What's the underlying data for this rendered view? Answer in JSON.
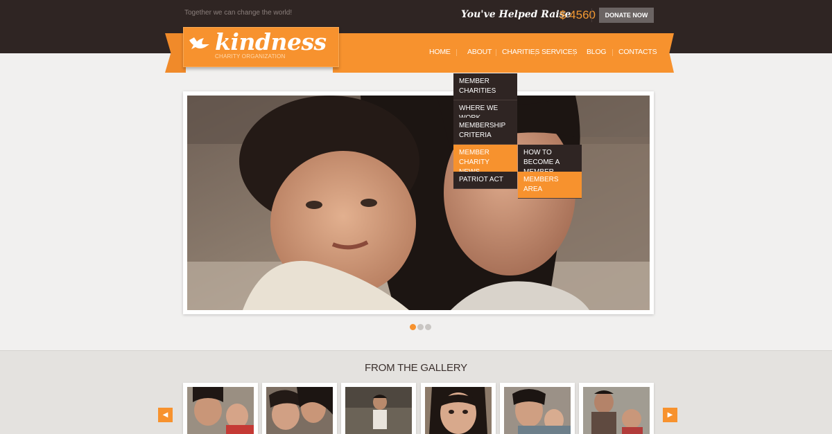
{
  "header": {
    "tagline": "Together we can change the world!",
    "raise_label": "You've Helped Raise",
    "raise_amount": "$ 4560",
    "donate_label": "DONATE NOW"
  },
  "logo": {
    "title": "kindness",
    "subtitle": "CHARITY ORGANIZATION"
  },
  "nav": {
    "items": [
      "HOME",
      "ABOUT",
      "CHARITIES",
      "SERVICES",
      "BLOG",
      "CONTACTS"
    ]
  },
  "dropdown": {
    "items": [
      {
        "label": "MEMBER CHARITIES"
      },
      {
        "label": "WHERE WE WORK"
      },
      {
        "label": "MEMBERSHIP CRITERIA"
      },
      {
        "label": "MEMBER CHARITY NEWS"
      },
      {
        "label": "PATRIOT ACT"
      }
    ],
    "submenu": [
      {
        "label": "HOW TO BECOME A MEMBER"
      },
      {
        "label": "MEMBERS AREA"
      }
    ]
  },
  "slider": {
    "active_index": 0,
    "count": 3
  },
  "gallery": {
    "title": "FROM THE GALLERY",
    "prev_icon": "arrow-left-icon",
    "next_icon": "arrow-right-icon"
  },
  "colors": {
    "accent": "#f7922e",
    "dark": "#2f2523",
    "background": "#f1f0ef"
  }
}
